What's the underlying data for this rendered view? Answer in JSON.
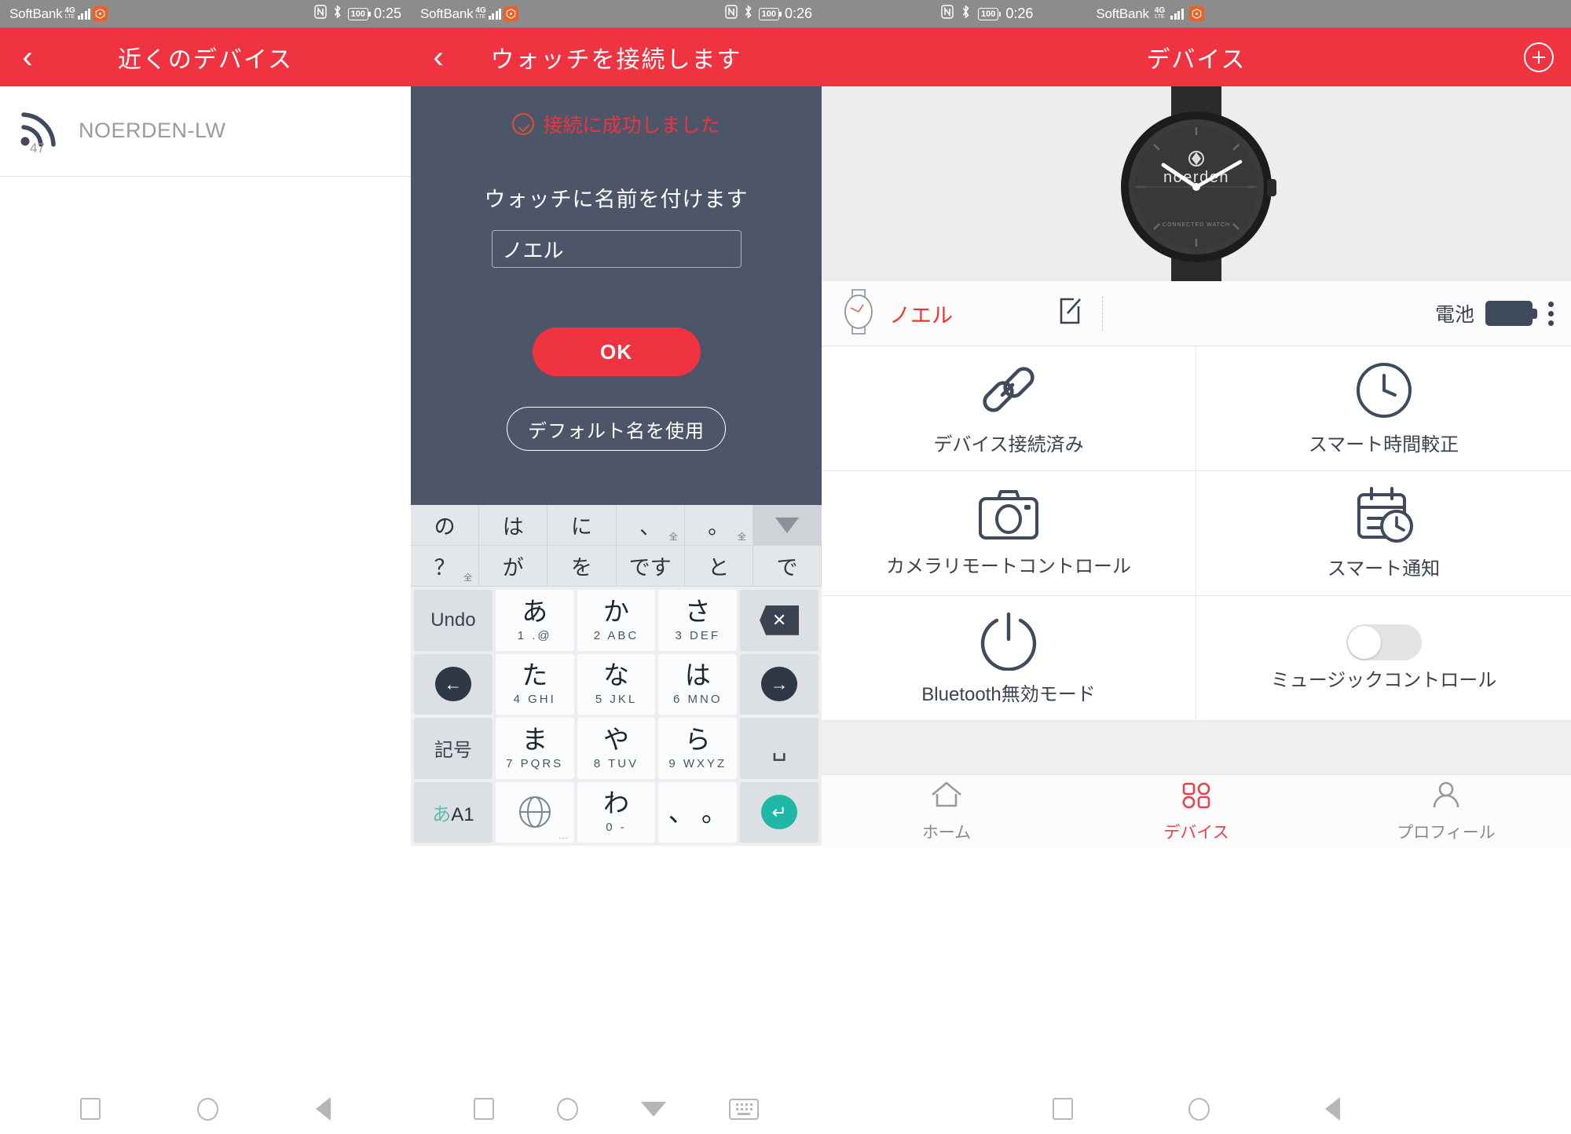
{
  "colors": {
    "accent": "#ef3340",
    "statusbar": "#8c8c8c",
    "dialog_bg": "#4c5668",
    "teal": "#1fb8a6"
  },
  "left_panel": {
    "status": {
      "carrier": "SoftBank",
      "net": "4G",
      "net_sub": "LTE",
      "nfc": "N",
      "bluetooth": "✶",
      "battery": "100",
      "time": "0:25"
    },
    "appbar": {
      "back": "‹",
      "title": "近くのデバイス"
    },
    "devices": [
      {
        "name": "NOERDEN-LW",
        "rssi": "47",
        "icon": "wifi-signal-icon"
      }
    ]
  },
  "center_panel": {
    "status": {
      "carrier": "SoftBank",
      "net": "4G",
      "net_sub": "LTE",
      "nfc": "N",
      "bluetooth": "✶",
      "battery": "100",
      "time": "0:26"
    },
    "appbar": {
      "back": "‹",
      "title": "ウォッチを接続します"
    },
    "dialog": {
      "success_text": "接続に成功しました",
      "name_label": "ウォッチに名前を付けます",
      "name_value": "ノエル",
      "name_placeholder": "ノエル",
      "ok_label": "OK",
      "default_label": "デフォルト名を使用"
    },
    "keyboard": {
      "suggestions_row1": [
        {
          "main": "の",
          "sub": ""
        },
        {
          "main": "は",
          "sub": ""
        },
        {
          "main": "に",
          "sub": ""
        },
        {
          "main": "、",
          "sub": "全"
        },
        {
          "main": "。",
          "sub": "全"
        }
      ],
      "suggestions_row2": [
        {
          "main": "？",
          "sub": "全"
        },
        {
          "main": "が",
          "sub": ""
        },
        {
          "main": "を",
          "sub": ""
        },
        {
          "main": "です",
          "sub": ""
        },
        {
          "main": "と",
          "sub": ""
        },
        {
          "main": "で",
          "sub": ""
        }
      ],
      "collapse_icon": "chevron-down-icon",
      "keys": [
        {
          "type": "fn",
          "label": "Undo",
          "name": "undo-key"
        },
        {
          "type": "char",
          "main": "あ",
          "hint": "1  .@",
          "name": "key-a"
        },
        {
          "type": "char",
          "main": "か",
          "hint": "2  ABC",
          "name": "key-ka"
        },
        {
          "type": "char",
          "main": "さ",
          "hint": "3  DEF",
          "name": "key-sa"
        },
        {
          "type": "icon",
          "icon": "backspace-icon",
          "name": "backspace-key"
        },
        {
          "type": "icon",
          "icon": "arrow-left-icon",
          "name": "cursor-left-key"
        },
        {
          "type": "char",
          "main": "た",
          "hint": "4  GHI",
          "name": "key-ta"
        },
        {
          "type": "char",
          "main": "な",
          "hint": "5  JKL",
          "name": "key-na"
        },
        {
          "type": "char",
          "main": "は",
          "hint": "6  MNO",
          "name": "key-ha"
        },
        {
          "type": "icon",
          "icon": "arrow-right-icon",
          "name": "cursor-right-key"
        },
        {
          "type": "fn",
          "label": "記号",
          "name": "symbols-key"
        },
        {
          "type": "char",
          "main": "ま",
          "hint": "7 PQRS",
          "name": "key-ma"
        },
        {
          "type": "char",
          "main": "や",
          "hint": "8  TUV",
          "name": "key-ya"
        },
        {
          "type": "char",
          "main": "ら",
          "hint": "9 WXYZ",
          "name": "key-ra"
        },
        {
          "type": "icon",
          "icon": "space-icon",
          "name": "space-key"
        },
        {
          "type": "mode",
          "kana": "あ",
          "alnum": "A1",
          "name": "input-mode-key"
        },
        {
          "type": "globe",
          "icon": "globe-icon",
          "dots": "…",
          "name": "language-key"
        },
        {
          "type": "char",
          "main": "わ",
          "hint": "0   -",
          "name": "key-wa"
        },
        {
          "type": "char",
          "main": "、  。",
          "hint": "",
          "name": "key-punct"
        },
        {
          "type": "icon",
          "icon": "enter-icon",
          "name": "enter-key"
        }
      ]
    }
  },
  "right_panel": {
    "status": {
      "carrier": "SoftBank",
      "net": "4G",
      "net_sub": "LTE",
      "nfc": "N",
      "bluetooth": "✶",
      "battery": "100",
      "time": "0:26"
    },
    "appbar": {
      "title": "デバイス",
      "add": "add-icon"
    },
    "watch": {
      "brand": "noerden",
      "subtitle": "CONNECTED WATCH"
    },
    "device_header": {
      "watch_icon": "watch-face-icon",
      "name": "ノエル",
      "edit_icon": "edit-icon",
      "battery_label": "電池",
      "battery_icon": "battery-full-icon",
      "menu_icon": "kebab-menu-icon"
    },
    "features": [
      {
        "label": "デバイス接続済み",
        "icon": "link-icon"
      },
      {
        "label": "スマート時間較正",
        "icon": "clock-icon"
      },
      {
        "label": "カメラリモートコントロール",
        "icon": "camera-icon"
      },
      {
        "label": "スマート通知",
        "icon": "calendar-clock-icon"
      },
      {
        "label": "Bluetooth無効モード",
        "icon": "power-icon"
      },
      {
        "label": "ミュージックコントロール",
        "icon": "toggle-off-icon",
        "toggle": "off"
      }
    ],
    "tabs": [
      {
        "label": "ホーム",
        "icon": "home-icon",
        "active": false
      },
      {
        "label": "デバイス",
        "icon": "grid-icon",
        "active": true
      },
      {
        "label": "プロフィール",
        "icon": "person-icon",
        "active": false
      }
    ]
  },
  "navbars": {
    "left": [
      "recents-icon",
      "home-icon",
      "back-icon"
    ],
    "center": [
      "recents-icon",
      "home-icon",
      "hide-keyboard-icon",
      "keyboard-switch-icon"
    ],
    "right": [
      "recents-icon",
      "home-icon",
      "back-icon"
    ]
  }
}
